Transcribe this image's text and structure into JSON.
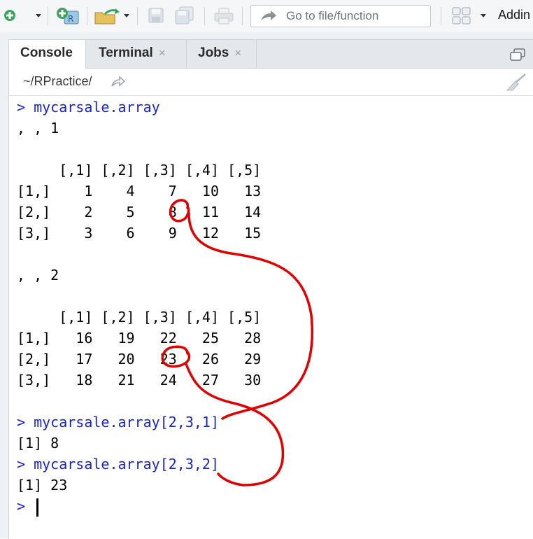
{
  "toolbar": {
    "goto_placeholder": "Go to file/function",
    "addins_label": "Addin"
  },
  "tabs": [
    {
      "label": "Console",
      "closable": false
    },
    {
      "label": "Terminal",
      "closable": true
    },
    {
      "label": "Jobs",
      "closable": true
    }
  ],
  "close_glyph": "×",
  "working_dir": "~/RPractice/",
  "console": {
    "prompt": ">",
    "lines": [
      {
        "type": "cmd",
        "text": "mycarsale.array"
      },
      {
        "type": "out",
        "text": ", , 1"
      },
      {
        "type": "out",
        "text": ""
      },
      {
        "type": "out",
        "text": "     [,1] [,2] [,3] [,4] [,5]"
      },
      {
        "type": "out",
        "text": "[1,]    1    4    7   10   13"
      },
      {
        "type": "out",
        "text": "[2,]    2    5    8   11   14"
      },
      {
        "type": "out",
        "text": "[3,]    3    6    9   12   15"
      },
      {
        "type": "out",
        "text": ""
      },
      {
        "type": "out",
        "text": ", , 2"
      },
      {
        "type": "out",
        "text": ""
      },
      {
        "type": "out",
        "text": "     [,1] [,2] [,3] [,4] [,5]"
      },
      {
        "type": "out",
        "text": "[1,]   16   19   22   25   28"
      },
      {
        "type": "out",
        "text": "[2,]   17   20   23   26   29"
      },
      {
        "type": "out",
        "text": "[3,]   18   21   24   27   30"
      },
      {
        "type": "out",
        "text": ""
      },
      {
        "type": "cmd",
        "text": "mycarsale.array[2,3,1]"
      },
      {
        "type": "out",
        "text": "[1] 8"
      },
      {
        "type": "cmd",
        "text": "mycarsale.array[2,3,2]"
      },
      {
        "type": "out",
        "text": "[1] 23"
      },
      {
        "type": "input",
        "text": ""
      }
    ]
  },
  "colors": {
    "command": "#1b22c8",
    "annotation": "#e00000"
  }
}
